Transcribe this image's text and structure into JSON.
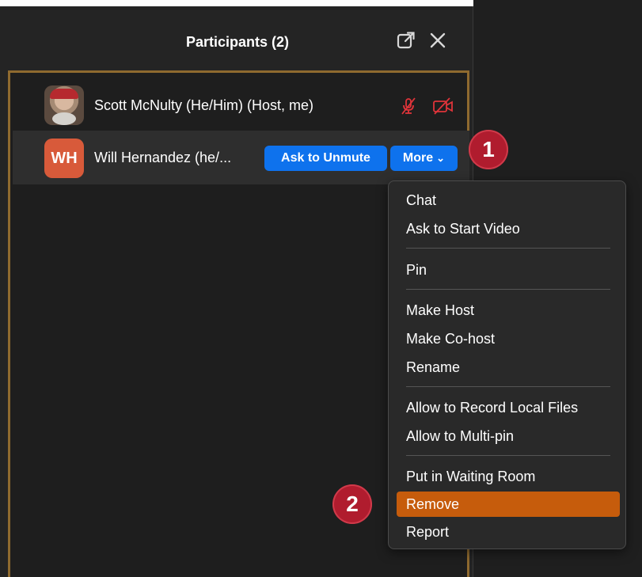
{
  "panel": {
    "title": "Participants (2)",
    "popout_icon": "external-link-icon",
    "close_icon": "close-icon"
  },
  "participants": [
    {
      "name": "Scott McNulty (He/Him) (Host, me)",
      "avatar": "photo",
      "mic_status": "muted",
      "video_status": "off"
    },
    {
      "name": "Will Hernandez (he/...",
      "initials": "WH",
      "ask_unmute_label": "Ask to Unmute",
      "more_label": "More"
    }
  ],
  "menu": {
    "groups": [
      [
        "Chat",
        "Ask to Start Video"
      ],
      [
        "Pin"
      ],
      [
        "Make Host",
        "Make Co-host",
        "Rename"
      ],
      [
        "Allow to Record Local Files",
        "Allow to Multi-pin"
      ],
      [
        "Put in Waiting Room",
        "Remove",
        "Report"
      ]
    ],
    "highlighted": "Remove"
  },
  "annotations": {
    "step1": "1",
    "step2": "2"
  },
  "colors": {
    "button_blue": "#0e72ed",
    "highlight_orange": "#c65c0c",
    "badge_red": "#b01c2e",
    "muted_red": "#e0343a",
    "list_border": "#8f6a2f"
  }
}
